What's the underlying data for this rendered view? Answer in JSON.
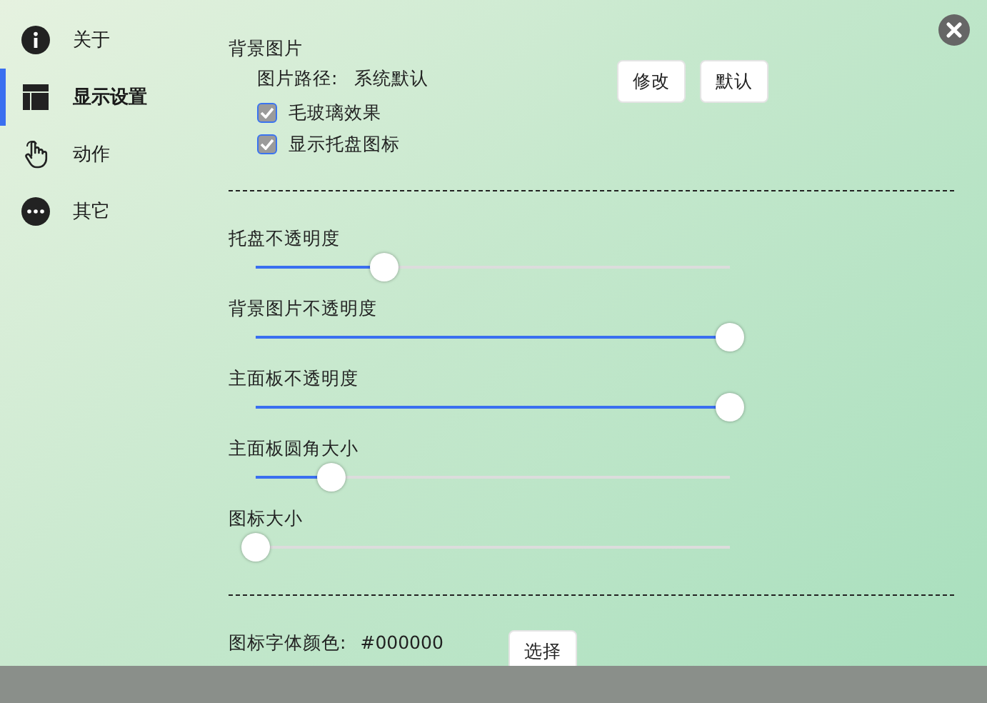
{
  "sidebar": {
    "items": [
      {
        "label": "关于",
        "selected": false
      },
      {
        "label": "显示设置",
        "selected": true
      },
      {
        "label": "动作",
        "selected": false
      },
      {
        "label": "其它",
        "selected": false
      }
    ]
  },
  "background": {
    "title": "背景图片",
    "path_label": "图片路径:",
    "path_value": "系统默认",
    "buttons": [
      "修改",
      "默认"
    ],
    "options": [
      {
        "label": "毛玻璃效果",
        "checked": true
      },
      {
        "label": "显示托盘图标",
        "checked": true
      }
    ]
  },
  "sliders": [
    {
      "label": "托盘不透明度",
      "level": 0.27
    },
    {
      "label": "背景图片不透明度",
      "level": 1
    },
    {
      "label": "主面板不透明度",
      "level": 1
    },
    {
      "label": "主面板圆角大小",
      "level": 0.16
    },
    {
      "label": "图标大小",
      "level": 0
    }
  ],
  "icon_color": {
    "label": "图标字体颜色:",
    "value": "#000000",
    "button": "选择"
  }
}
